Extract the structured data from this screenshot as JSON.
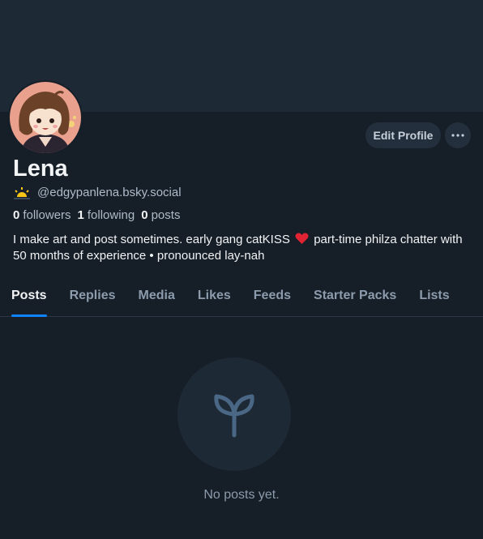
{
  "profile": {
    "name": "Lena",
    "handle": "@edgypanlena.bsky.social",
    "followers_count": "0",
    "followers_label": "followers",
    "following_count": "1",
    "following_label": "following",
    "posts_count": "0",
    "posts_label": "posts",
    "bio_part1": "I make art and post sometimes. early gang catKISS",
    "bio_part2": "part-time philza chatter with 50 months of experience • pronounced lay-nah"
  },
  "actions": {
    "edit_profile": "Edit Profile",
    "more_icon": "ellipsis-icon"
  },
  "tabs": [
    {
      "label": "Posts",
      "active": true
    },
    {
      "label": "Replies",
      "active": false
    },
    {
      "label": "Media",
      "active": false
    },
    {
      "label": "Likes",
      "active": false
    },
    {
      "label": "Feeds",
      "active": false
    },
    {
      "label": "Starter Packs",
      "active": false
    },
    {
      "label": "Lists",
      "active": false
    }
  ],
  "empty_state": {
    "icon": "seedling-icon",
    "message": "No posts yet."
  },
  "colors": {
    "background": "#161e27",
    "banner": "#1e2936",
    "accent": "#1083fe",
    "text_muted": "#8c9cad"
  }
}
